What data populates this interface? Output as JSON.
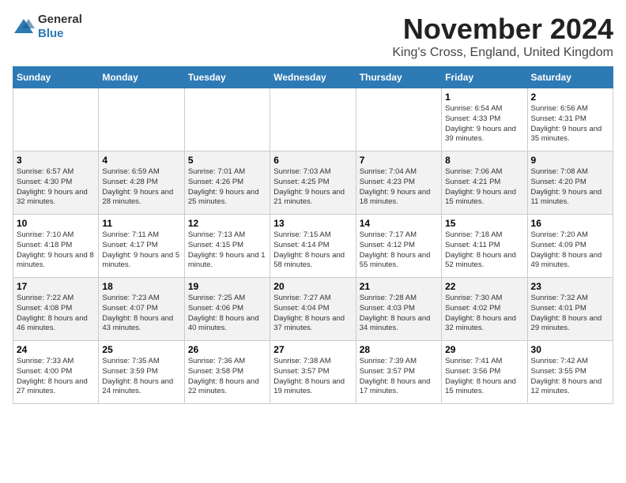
{
  "header": {
    "logo_general": "General",
    "logo_blue": "Blue",
    "title": "November 2024",
    "subtitle": "King's Cross, England, United Kingdom"
  },
  "weekdays": [
    "Sunday",
    "Monday",
    "Tuesday",
    "Wednesday",
    "Thursday",
    "Friday",
    "Saturday"
  ],
  "weeks": [
    [
      {
        "day": "",
        "info": ""
      },
      {
        "day": "",
        "info": ""
      },
      {
        "day": "",
        "info": ""
      },
      {
        "day": "",
        "info": ""
      },
      {
        "day": "",
        "info": ""
      },
      {
        "day": "1",
        "info": "Sunrise: 6:54 AM\nSunset: 4:33 PM\nDaylight: 9 hours and 39 minutes."
      },
      {
        "day": "2",
        "info": "Sunrise: 6:56 AM\nSunset: 4:31 PM\nDaylight: 9 hours and 35 minutes."
      }
    ],
    [
      {
        "day": "3",
        "info": "Sunrise: 6:57 AM\nSunset: 4:30 PM\nDaylight: 9 hours and 32 minutes."
      },
      {
        "day": "4",
        "info": "Sunrise: 6:59 AM\nSunset: 4:28 PM\nDaylight: 9 hours and 28 minutes."
      },
      {
        "day": "5",
        "info": "Sunrise: 7:01 AM\nSunset: 4:26 PM\nDaylight: 9 hours and 25 minutes."
      },
      {
        "day": "6",
        "info": "Sunrise: 7:03 AM\nSunset: 4:25 PM\nDaylight: 9 hours and 21 minutes."
      },
      {
        "day": "7",
        "info": "Sunrise: 7:04 AM\nSunset: 4:23 PM\nDaylight: 9 hours and 18 minutes."
      },
      {
        "day": "8",
        "info": "Sunrise: 7:06 AM\nSunset: 4:21 PM\nDaylight: 9 hours and 15 minutes."
      },
      {
        "day": "9",
        "info": "Sunrise: 7:08 AM\nSunset: 4:20 PM\nDaylight: 9 hours and 11 minutes."
      }
    ],
    [
      {
        "day": "10",
        "info": "Sunrise: 7:10 AM\nSunset: 4:18 PM\nDaylight: 9 hours and 8 minutes."
      },
      {
        "day": "11",
        "info": "Sunrise: 7:11 AM\nSunset: 4:17 PM\nDaylight: 9 hours and 5 minutes."
      },
      {
        "day": "12",
        "info": "Sunrise: 7:13 AM\nSunset: 4:15 PM\nDaylight: 9 hours and 1 minute."
      },
      {
        "day": "13",
        "info": "Sunrise: 7:15 AM\nSunset: 4:14 PM\nDaylight: 8 hours and 58 minutes."
      },
      {
        "day": "14",
        "info": "Sunrise: 7:17 AM\nSunset: 4:12 PM\nDaylight: 8 hours and 55 minutes."
      },
      {
        "day": "15",
        "info": "Sunrise: 7:18 AM\nSunset: 4:11 PM\nDaylight: 8 hours and 52 minutes."
      },
      {
        "day": "16",
        "info": "Sunrise: 7:20 AM\nSunset: 4:09 PM\nDaylight: 8 hours and 49 minutes."
      }
    ],
    [
      {
        "day": "17",
        "info": "Sunrise: 7:22 AM\nSunset: 4:08 PM\nDaylight: 8 hours and 46 minutes."
      },
      {
        "day": "18",
        "info": "Sunrise: 7:23 AM\nSunset: 4:07 PM\nDaylight: 8 hours and 43 minutes."
      },
      {
        "day": "19",
        "info": "Sunrise: 7:25 AM\nSunset: 4:06 PM\nDaylight: 8 hours and 40 minutes."
      },
      {
        "day": "20",
        "info": "Sunrise: 7:27 AM\nSunset: 4:04 PM\nDaylight: 8 hours and 37 minutes."
      },
      {
        "day": "21",
        "info": "Sunrise: 7:28 AM\nSunset: 4:03 PM\nDaylight: 8 hours and 34 minutes."
      },
      {
        "day": "22",
        "info": "Sunrise: 7:30 AM\nSunset: 4:02 PM\nDaylight: 8 hours and 32 minutes."
      },
      {
        "day": "23",
        "info": "Sunrise: 7:32 AM\nSunset: 4:01 PM\nDaylight: 8 hours and 29 minutes."
      }
    ],
    [
      {
        "day": "24",
        "info": "Sunrise: 7:33 AM\nSunset: 4:00 PM\nDaylight: 8 hours and 27 minutes."
      },
      {
        "day": "25",
        "info": "Sunrise: 7:35 AM\nSunset: 3:59 PM\nDaylight: 8 hours and 24 minutes."
      },
      {
        "day": "26",
        "info": "Sunrise: 7:36 AM\nSunset: 3:58 PM\nDaylight: 8 hours and 22 minutes."
      },
      {
        "day": "27",
        "info": "Sunrise: 7:38 AM\nSunset: 3:57 PM\nDaylight: 8 hours and 19 minutes."
      },
      {
        "day": "28",
        "info": "Sunrise: 7:39 AM\nSunset: 3:57 PM\nDaylight: 8 hours and 17 minutes."
      },
      {
        "day": "29",
        "info": "Sunrise: 7:41 AM\nSunset: 3:56 PM\nDaylight: 8 hours and 15 minutes."
      },
      {
        "day": "30",
        "info": "Sunrise: 7:42 AM\nSunset: 3:55 PM\nDaylight: 8 hours and 12 minutes."
      }
    ]
  ]
}
